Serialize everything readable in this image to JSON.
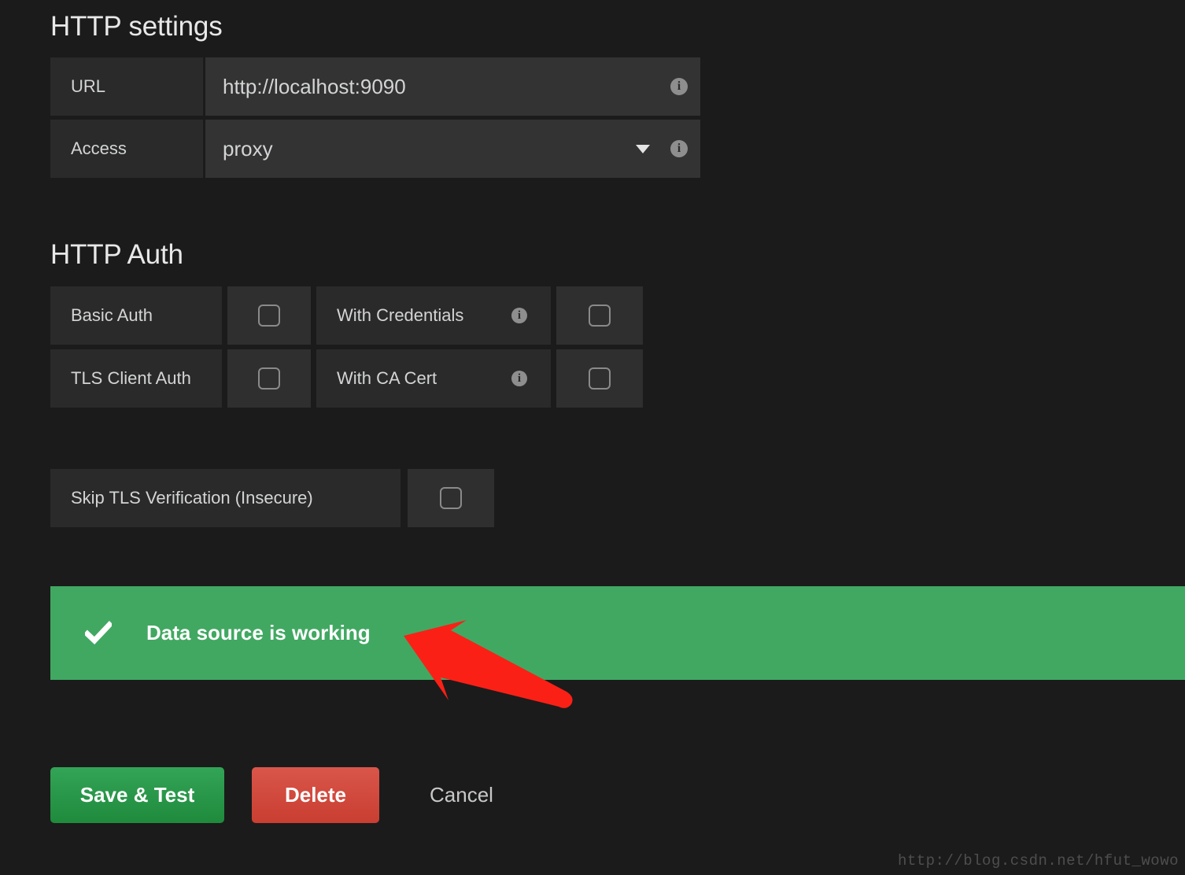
{
  "sections": {
    "http_settings": {
      "title": "HTTP settings",
      "fields": [
        {
          "label": "URL",
          "value": "http://localhost:9090",
          "info_icon": "info-icon",
          "type": "text"
        },
        {
          "label": "Access",
          "value": "proxy",
          "info_icon": "info-icon",
          "type": "select",
          "caret_icon": "chevron-down-icon"
        }
      ]
    },
    "http_auth": {
      "title": "HTTP Auth",
      "rows": [
        {
          "left_label": "Basic Auth",
          "left_checked": false,
          "right_label": "With Credentials",
          "right_info_icon": "info-icon",
          "right_checked": false
        },
        {
          "left_label": "TLS Client Auth",
          "left_checked": false,
          "right_label": "With CA Cert",
          "right_info_icon": "info-icon",
          "right_checked": false
        }
      ]
    },
    "skip_tls": {
      "label": "Skip TLS Verification (Insecure)",
      "checked": false
    }
  },
  "banner": {
    "icon": "check-icon",
    "text": "Data source is working",
    "color": "#41a862",
    "text_color": "#ffffff"
  },
  "annotation": {
    "type": "arrow",
    "color": "#fb2016",
    "points_to": "Data source is working"
  },
  "actions": {
    "save_label": "Save & Test",
    "delete_label": "Delete",
    "cancel_label": "Cancel",
    "save_color": "#2a9248",
    "delete_color": "#ce4538"
  },
  "watermark": {
    "text": "http://blog.csdn.net/hfut_wowo"
  },
  "theme": {
    "page_background": "#1b1b1b",
    "label_panel": "#2a2a2a",
    "input_panel": "#333333",
    "checkbox_panel": "#2f2f2f",
    "text_color": "#d3d4d5"
  }
}
